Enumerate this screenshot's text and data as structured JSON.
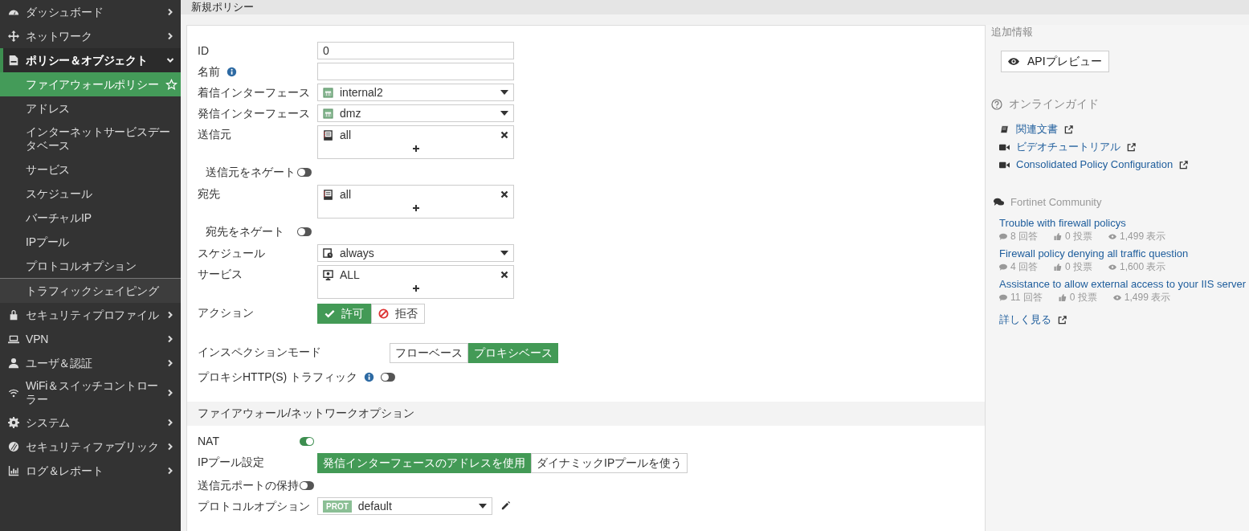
{
  "header": {
    "title": "新規ポリシー"
  },
  "sidebar": {
    "items": [
      {
        "label": "ダッシュボード",
        "expanded": false
      },
      {
        "label": "ネットワーク",
        "expanded": false
      },
      {
        "label": "ポリシー＆オブジェクト",
        "expanded": true,
        "children": [
          {
            "label": "ファイアウォールポリシー",
            "selected": true,
            "separated": false
          },
          {
            "label": "アドレス",
            "selected": false,
            "separated": false
          },
          {
            "label": "インターネットサービスデータベース",
            "selected": false,
            "separated": false
          },
          {
            "label": "サービス",
            "selected": false,
            "separated": false
          },
          {
            "label": "スケジュール",
            "selected": false,
            "separated": false
          },
          {
            "label": "バーチャルIP",
            "selected": false,
            "separated": false
          },
          {
            "label": "IPプール",
            "selected": false,
            "separated": false
          },
          {
            "label": "プロトコルオプション",
            "selected": false,
            "separated": false
          },
          {
            "label": "トラフィックシェイピング",
            "selected": false,
            "separated": true
          }
        ]
      },
      {
        "label": "セキュリティプロファイル",
        "expanded": false
      },
      {
        "label": "VPN",
        "expanded": false
      },
      {
        "label": "ユーザ＆認証",
        "expanded": false
      },
      {
        "label": "WiFi＆スイッチコントローラー",
        "expanded": false
      },
      {
        "label": "システム",
        "expanded": false
      },
      {
        "label": "セキュリティファブリック",
        "expanded": false
      },
      {
        "label": "ログ＆レポート",
        "expanded": false
      }
    ]
  },
  "form": {
    "rows": [
      {
        "kind": "input",
        "label": "ID",
        "value": "0"
      },
      {
        "kind": "input",
        "label": "名前",
        "info": true
      },
      {
        "kind": "port",
        "label": "着信インターフェース",
        "value": "internal2"
      },
      {
        "kind": "port",
        "label": "発信インターフェース",
        "value": "dmz"
      },
      {
        "kind": "address",
        "label": "送信元",
        "value": "all"
      },
      {
        "kind": "negate",
        "label": "送信元をネゲート",
        "on": false
      },
      {
        "kind": "address",
        "label": "宛先",
        "value": "all"
      },
      {
        "kind": "negate",
        "label": "宛先をネゲート",
        "on": false
      },
      {
        "kind": "clock",
        "label": "スケジュール",
        "value": "always"
      },
      {
        "kind": "service",
        "label": "サービス",
        "value": "ALL"
      },
      {
        "kind": "action",
        "label": "アクション",
        "options": [
          {
            "label": "許可",
            "selected": true
          },
          {
            "label": "拒否",
            "selected": false
          }
        ]
      },
      {
        "kind": "mode",
        "label": "インスペクションモード",
        "options": [
          {
            "label": "フローベース",
            "selected": false
          },
          {
            "label": "プロキシベース",
            "selected": true
          }
        ]
      },
      {
        "kind": "toggle",
        "label": "プロキシHTTP(S) トラフィック",
        "info": true,
        "on": false
      }
    ],
    "section": {
      "title": "ファイアウォール/ネットワークオプション",
      "rows": [
        {
          "kind": "toggle",
          "label": "NAT",
          "on": true
        },
        {
          "kind": "choice",
          "label": "IPプール設定",
          "options": [
            {
              "label": "発信インターフェースのアドレスを使用",
              "selected": true
            },
            {
              "label": "ダイナミックIPプールを使う",
              "selected": false
            }
          ]
        },
        {
          "kind": "toggle",
          "label": "送信元ポートの保持",
          "on": false
        },
        {
          "kind": "profile",
          "label": "プロトコルオプション",
          "badge": "PROT",
          "value": "default"
        }
      ]
    }
  },
  "side_panel": {
    "title": "追加情報",
    "api_button": "APIプレビュー",
    "guide": {
      "title": "オンラインガイド",
      "links": [
        {
          "label": "関連文書"
        },
        {
          "label": "ビデオチュートリアル"
        },
        {
          "label": "Consolidated Policy Configuration"
        }
      ]
    },
    "community": {
      "title": "Fortinet Community",
      "posts": [
        {
          "title": "Trouble with firewall policys",
          "replies": "8 回答",
          "votes": "0 投票",
          "views": "1,499 表示"
        },
        {
          "title": "Firewall policy denying all traffic question",
          "replies": "4 回答",
          "votes": "0 投票",
          "views": "1,600 表示"
        },
        {
          "title": "Assistance to allow external access to your IIS server",
          "replies": "11 回答",
          "votes": "0 投票",
          "views": "1,499 表示"
        }
      ],
      "more": "詳しく見る"
    }
  }
}
